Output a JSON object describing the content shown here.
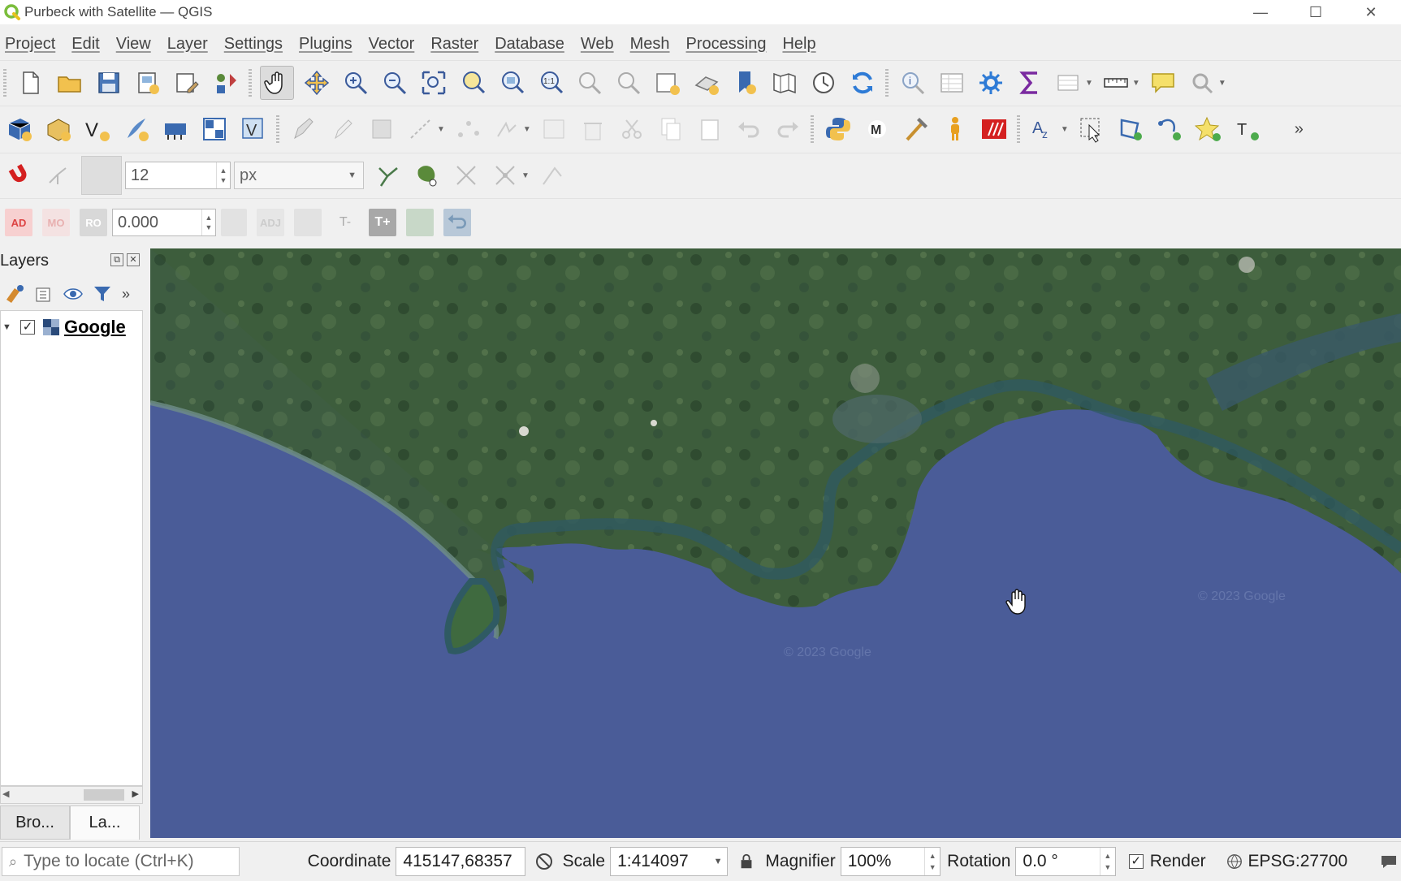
{
  "window": {
    "title": "Purbeck with Satellite — QGIS",
    "minimize": "—",
    "maximize": "☐",
    "close": "✕"
  },
  "menu": [
    "Project",
    "Edit",
    "View",
    "Layer",
    "Settings",
    "Plugins",
    "Vector",
    "Raster",
    "Database",
    "Web",
    "Mesh",
    "Processing",
    "Help"
  ],
  "snapping": {
    "tolerance": "12",
    "units": "px"
  },
  "labels_toolbar": {
    "btn_ad": "AD",
    "btn_mo": "MO",
    "btn_ro": "RO",
    "rotation_value": "0.000",
    "btn_tminus": "T-",
    "btn_tplus": "T+",
    "btn_adj": "ADJ"
  },
  "layers_panel": {
    "title": "Layers",
    "layers": [
      {
        "name": "Google",
        "checked": true
      }
    ],
    "tabs": [
      "Bro...",
      "La..."
    ]
  },
  "map": {
    "watermarks": [
      "© 2023 Google",
      "© 2023 Google"
    ]
  },
  "status": {
    "locator_placeholder": "Type to locate (Ctrl+K)",
    "coordinate_label": "Coordinate",
    "coordinate_value": "415147,68357",
    "scale_label": "Scale",
    "scale_value": "1:414097",
    "magnifier_label": "Magnifier",
    "magnifier_value": "100%",
    "rotation_label": "Rotation",
    "rotation_value": "0.0 °",
    "render_label": "Render",
    "render_checked": true,
    "crs": "EPSG:27700"
  },
  "colors": {
    "sea": "#4a5c98",
    "land": "#3a5a3a",
    "coast": "#2f5a63"
  }
}
